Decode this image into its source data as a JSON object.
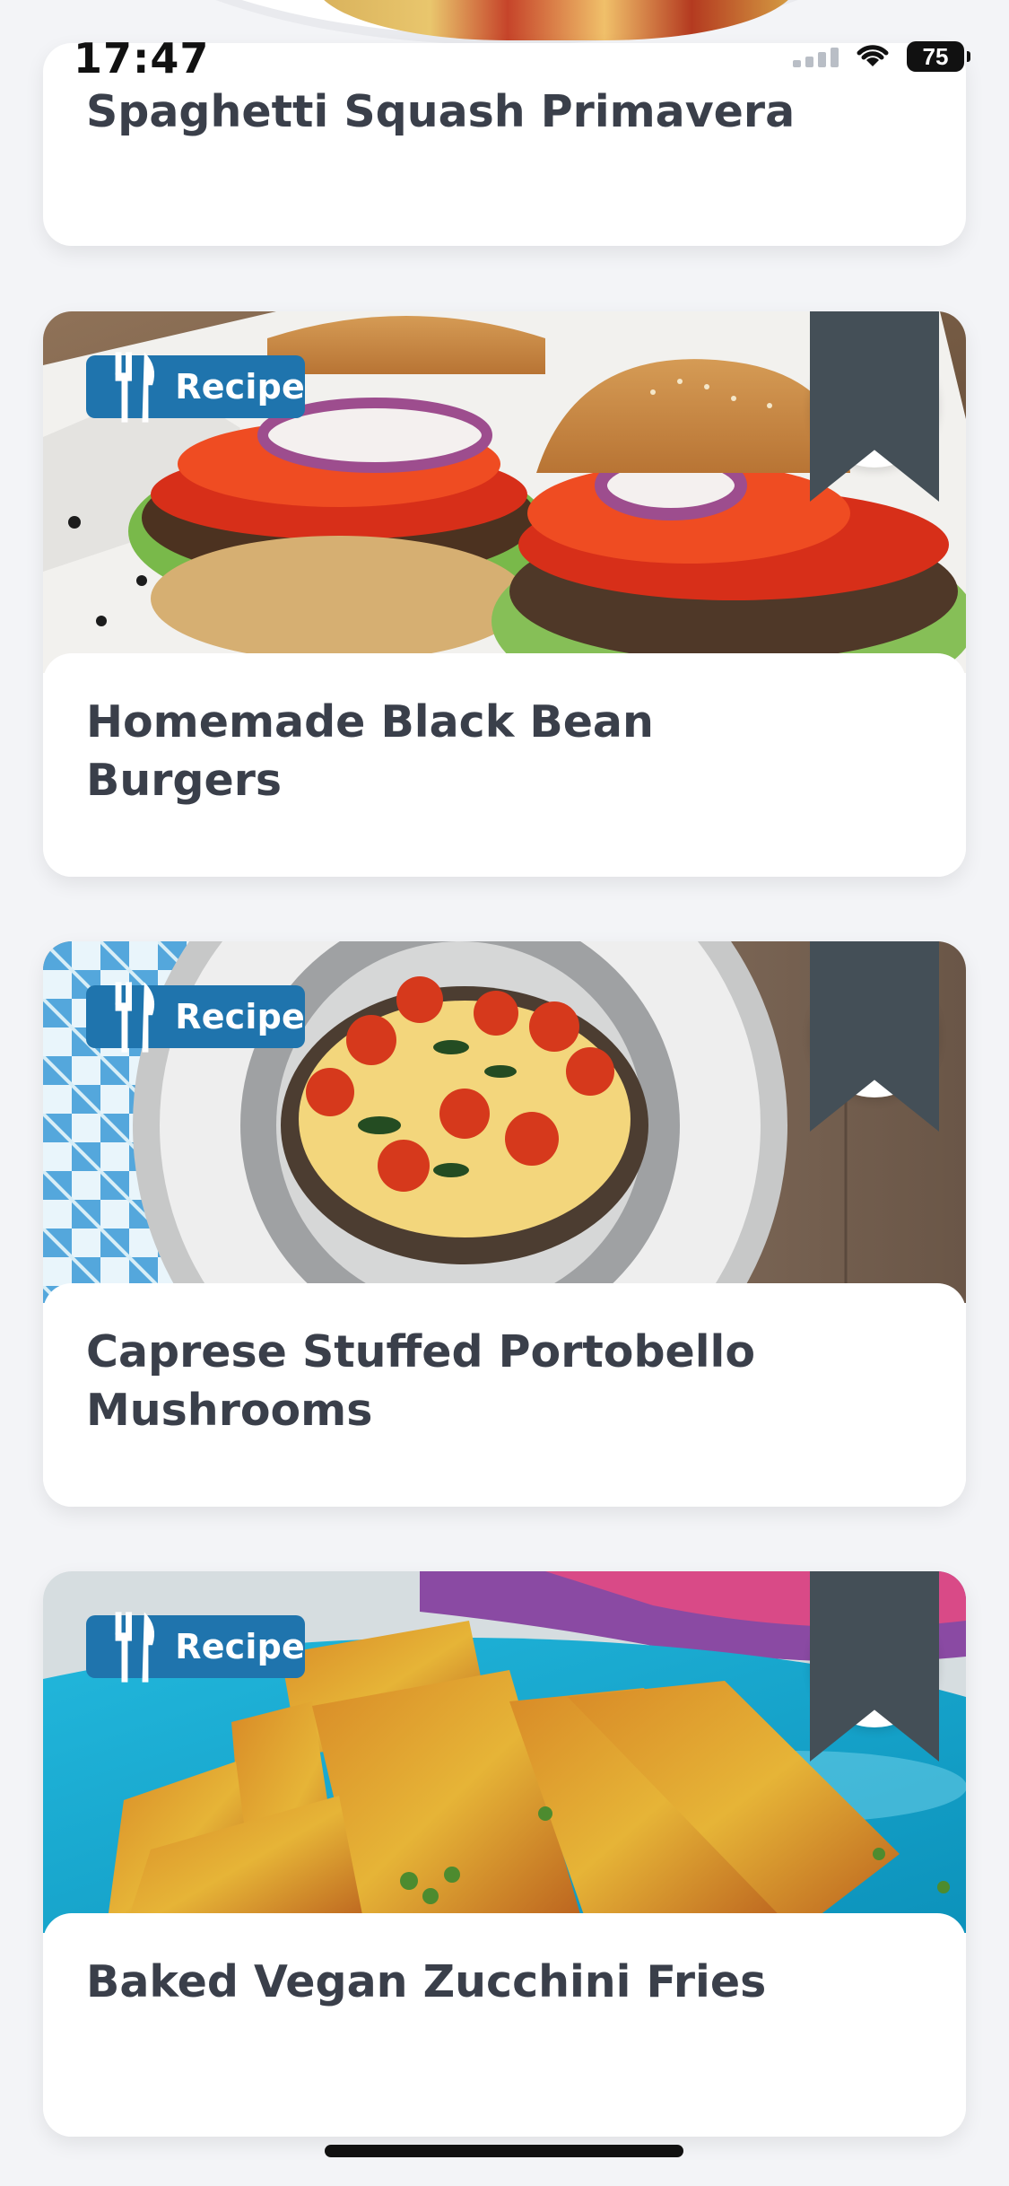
{
  "status_bar": {
    "time": "17:47",
    "battery": "75"
  },
  "top_card": {
    "title": "Spaghetti Squash Primavera"
  },
  "cards": [
    {
      "badge": "Recipe",
      "title": "Homemade Black Bean Burgers",
      "image_icon": "burger-photo",
      "bookmark_icon": "bookmark-icon"
    },
    {
      "badge": "Recipe",
      "title": "Caprese Stuffed Portobello Mushrooms",
      "image_icon": "mushroom-photo",
      "bookmark_icon": "bookmark-icon"
    },
    {
      "badge": "Recipe",
      "title": "Baked Vegan Zucchini Fries",
      "image_icon": "zucchini-photo",
      "bookmark_icon": "bookmark-icon"
    }
  ],
  "colors": {
    "page_background": "#f3f4f7",
    "badge": "#1f74ad",
    "title_text": "#3a3f4a",
    "bookmark": "#444f57"
  }
}
